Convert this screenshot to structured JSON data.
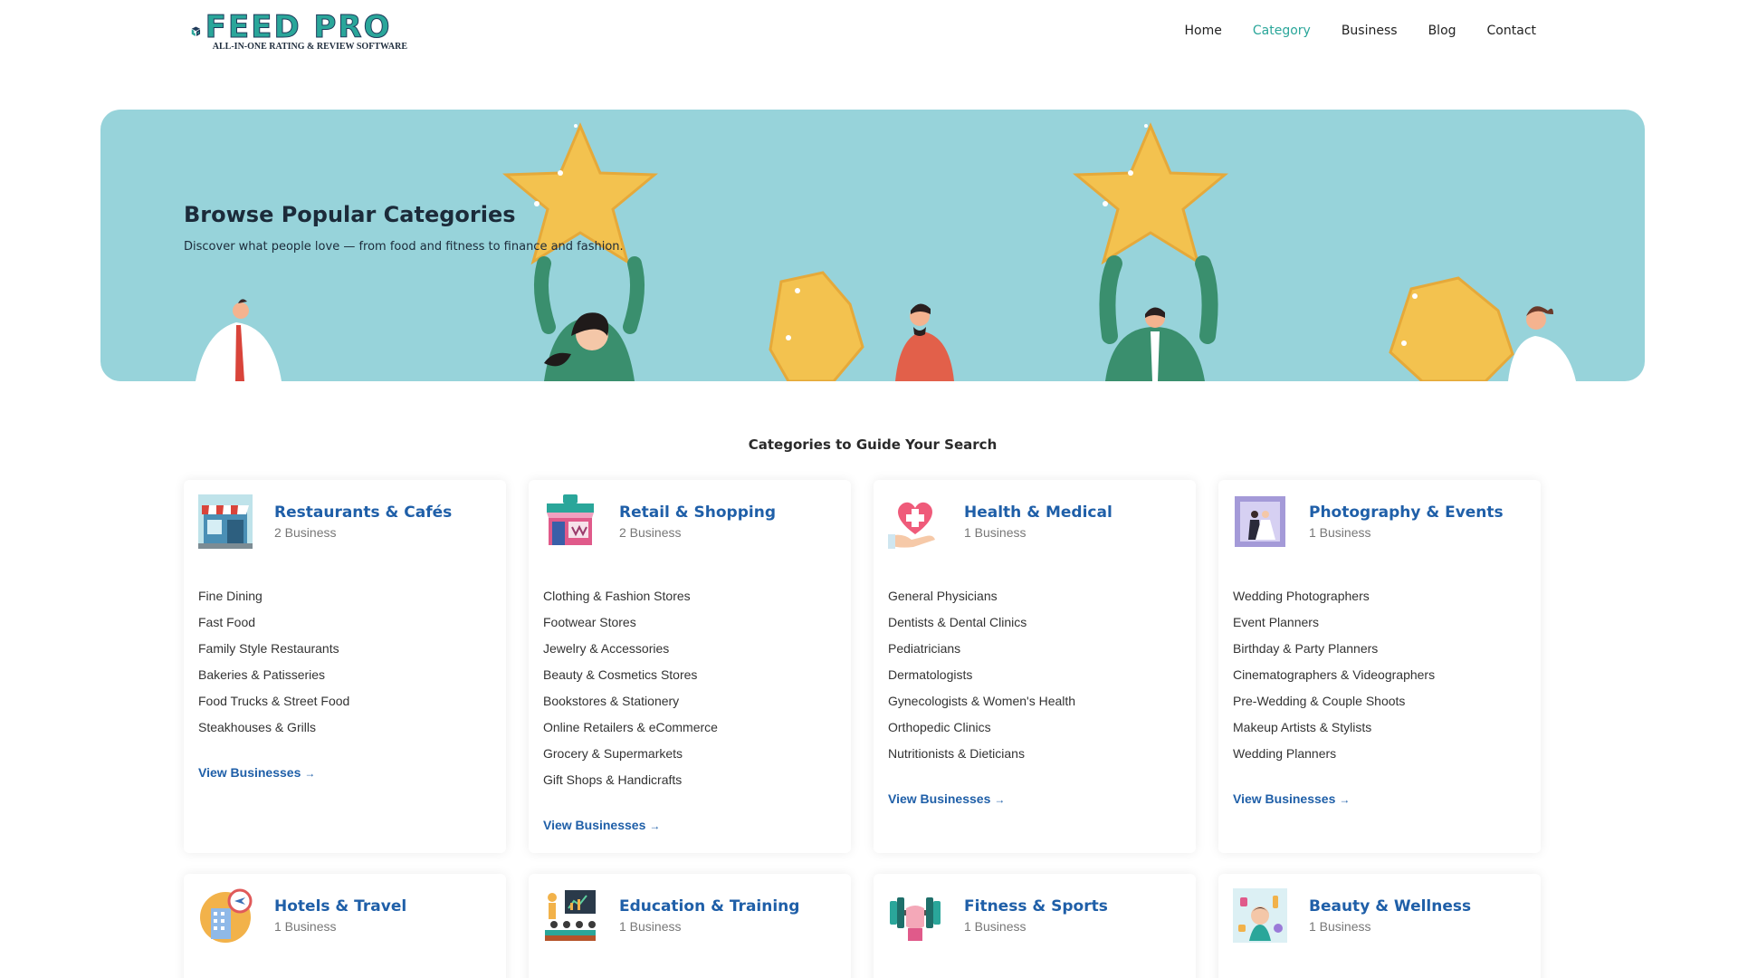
{
  "brand": {
    "name": "FEED PRO",
    "tagline": "ALL-IN-ONE RATING & REVIEW SOFTWARE"
  },
  "nav": {
    "items": [
      {
        "label": "Home",
        "active": false
      },
      {
        "label": "Category",
        "active": true
      },
      {
        "label": "Business",
        "active": false
      },
      {
        "label": "Blog",
        "active": false
      },
      {
        "label": "Contact",
        "active": false
      }
    ]
  },
  "hero": {
    "title": "Browse Popular Categories",
    "subtitle": "Discover what people love — from food and fitness to finance and fashion."
  },
  "section": {
    "title": "Categories to Guide Your Search"
  },
  "categories": [
    {
      "title": "Restaurants & Cafés",
      "count": "2 Business",
      "icon": "restaurant-storefront-icon",
      "items": [
        "Fine Dining",
        "Fast Food",
        "Family Style Restaurants",
        "Bakeries & Patisseries",
        "Food Trucks & Street Food",
        "Steakhouses & Grills"
      ],
      "link": "View Businesses",
      "arrow": "→"
    },
    {
      "title": "Retail & Shopping",
      "count": "2 Business",
      "icon": "shop-icon",
      "items": [
        "Clothing & Fashion Stores",
        "Footwear Stores",
        "Jewelry & Accessories",
        "Beauty & Cosmetics Stores",
        "Bookstores & Stationery",
        "Online Retailers & eCommerce",
        "Grocery & Supermarkets",
        "Gift Shops & Handicrafts"
      ],
      "link": "View Businesses",
      "arrow": "→"
    },
    {
      "title": "Health & Medical",
      "count": "1 Business",
      "icon": "heart-hand-icon",
      "items": [
        "General Physicians",
        "Dentists & Dental Clinics",
        "Pediatricians",
        "Dermatologists",
        "Gynecologists & Women's Health",
        "Orthopedic Clinics",
        "Nutritionists & Dieticians"
      ],
      "link": "View Businesses",
      "arrow": "→"
    },
    {
      "title": "Photography & Events",
      "count": "1 Business",
      "icon": "wedding-couple-icon",
      "items": [
        "Wedding Photographers",
        "Event Planners",
        "Birthday & Party Planners",
        "Cinematographers & Videographers",
        "Pre-Wedding & Couple Shoots",
        "Makeup Artists & Stylists",
        "Wedding Planners"
      ],
      "link": "View Businesses",
      "arrow": "→"
    },
    {
      "title": "Hotels & Travel",
      "count": "1 Business",
      "icon": "hotel-plane-icon",
      "items": [],
      "link": "",
      "arrow": ""
    },
    {
      "title": "Education & Training",
      "count": "1 Business",
      "icon": "classroom-icon",
      "items": [],
      "link": "",
      "arrow": ""
    },
    {
      "title": "Fitness & Sports",
      "count": "1 Business",
      "icon": "dumbbell-icon",
      "items": [],
      "link": "",
      "arrow": ""
    },
    {
      "title": "Beauty & Wellness",
      "count": "1 Business",
      "icon": "beauty-products-icon",
      "items": [],
      "link": "",
      "arrow": ""
    }
  ],
  "colors": {
    "accent": "#2aa69a",
    "link": "#1f5fa8",
    "hero_bg": "#97d3da",
    "star": "#f3c24f"
  }
}
